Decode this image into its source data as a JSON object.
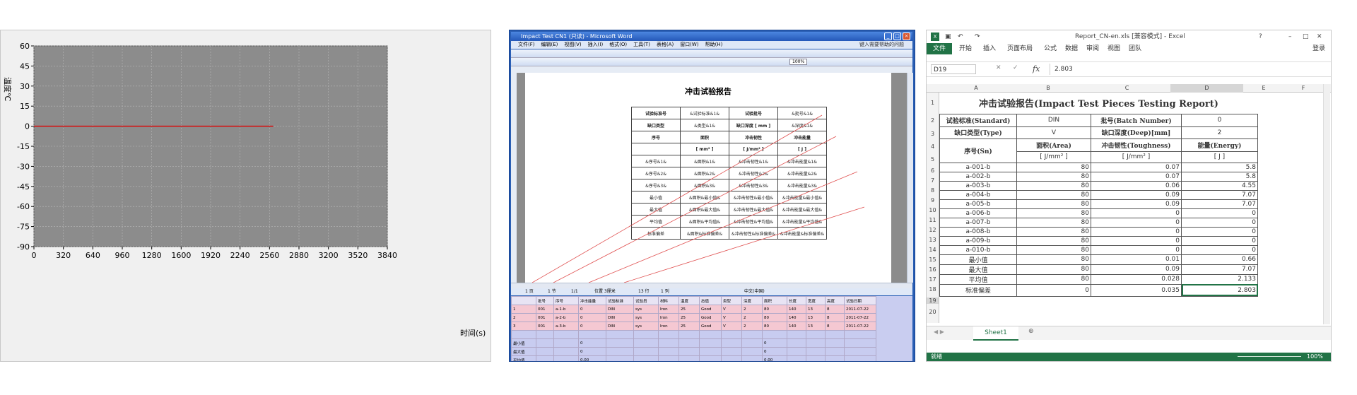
{
  "chart": {
    "ylabel": "温度℃",
    "xlabel": "时间(s)",
    "y_ticks": [
      "60",
      "45",
      "30",
      "15",
      "0",
      "-15",
      "-30",
      "-45",
      "-60",
      "-75",
      "-90"
    ],
    "x_ticks": [
      "0",
      "320",
      "640",
      "960",
      "1280",
      "1600",
      "1920",
      "2240",
      "2560",
      "2880",
      "3200",
      "3520",
      "3840"
    ]
  },
  "chart_data": {
    "type": "line",
    "ylabel": "温度℃",
    "xlabel": "时间(s)",
    "xlim": [
      0,
      3840
    ],
    "ylim": [
      -90,
      60
    ],
    "grid": true,
    "plot_bg": "#8c8c8c",
    "series": [
      {
        "color": "#e00000",
        "x": [
          0,
          2600
        ],
        "y": [
          0,
          0
        ]
      }
    ]
  },
  "word": {
    "title": "Impact Test CN1 (只读) - Microsoft Word",
    "menu": [
      "文件(F)",
      "编辑(E)",
      "视图(V)",
      "插入(I)",
      "格式(O)",
      "工具(T)",
      "表格(A)",
      "窗口(W)",
      "帮助(H)"
    ],
    "help_box": "键入需要帮助的问题",
    "zoom": "100%",
    "doc_title": "冲击试验报告",
    "template_rows": [
      [
        "试验标准号",
        "&试验标准&1&",
        "试验批号",
        "&批号&1&"
      ],
      [
        "缺口类型",
        "&类型&1&",
        "缺口深度 [ mm ]",
        "&深度&1&"
      ],
      [
        "序号",
        "面积",
        "冲击韧性",
        "冲击能量"
      ],
      [
        "",
        "[ mm² ]",
        "[ J/mm² ]",
        "[ J ]"
      ],
      [
        "&序号&1&",
        "&面积&1&",
        "&冲击韧性&1&",
        "&冲击能量&1&"
      ],
      [
        "&序号&2&",
        "&面积&2&",
        "&冲击韧性&2&",
        "&冲击能量&2&"
      ],
      [
        "&序号&3&",
        "&面积&3&",
        "&冲击韧性&3&",
        "&冲击能量&3&"
      ],
      [
        "最小值",
        "&面积&最小值&",
        "&冲击韧性&最小值&",
        "&冲击能量&最小值&"
      ],
      [
        "最大值",
        "&面积&最大值&",
        "&冲击韧性&最大值&",
        "&冲击能量&最大值&"
      ],
      [
        "平均值",
        "&面积&平均值&",
        "&冲击韧性&平均值&",
        "&冲击能量&平均值&"
      ],
      [
        "标准偏差",
        "&面积&标准偏差&",
        "&冲击韧性&标准偏差&",
        "&冲击能量&标准偏差&"
      ]
    ],
    "status": {
      "page": "1 页",
      "section": "1 节",
      "pages": "1/1",
      "pos": "位置 3厘米",
      "line": "13 行",
      "col": "1 列",
      "lang": "中文(中国)"
    },
    "grid_header": [
      "批号",
      "序号",
      "冲击能量",
      "试验标准",
      "试验员",
      "材料",
      "温度",
      "态值",
      "类型",
      "深度",
      "面积",
      "长度",
      "宽度",
      "高度",
      "试验日期"
    ],
    "grid_rows": [
      [
        "1",
        "001",
        "a-1-b",
        "0",
        "DIN",
        "sys",
        "Iron",
        "25",
        "Good",
        "V",
        "2",
        "80",
        "140",
        "13",
        "8",
        "2011-07-22"
      ],
      [
        "2",
        "001",
        "a-2-b",
        "0",
        "DIN",
        "sys",
        "Iron",
        "25",
        "Good",
        "V",
        "2",
        "80",
        "140",
        "13",
        "8",
        "2011-07-22"
      ],
      [
        "3",
        "001",
        "a-3-b",
        "0",
        "DIN",
        "sys",
        "Iron",
        "25",
        "Good",
        "V",
        "2",
        "80",
        "140",
        "13",
        "8",
        "2011-07-22"
      ]
    ],
    "grid_stats": [
      [
        "最小值",
        "0",
        "0"
      ],
      [
        "最大值",
        "0",
        "0"
      ],
      [
        "平均值",
        "0.00",
        "0.00"
      ],
      [
        "标准偏差",
        "0.00",
        "0.00"
      ]
    ]
  },
  "excel": {
    "title": "Report_CN-en.xls [兼容模式] - Excel",
    "tabs": [
      "文件",
      "开始",
      "插入",
      "页面布局",
      "公式",
      "数据",
      "审阅",
      "视图",
      "团队"
    ],
    "login": "登录",
    "namebox": "D19",
    "fx": "fx",
    "formula_value": "2.803",
    "col_headers": [
      "A",
      "B",
      "C",
      "D",
      "E",
      "F"
    ],
    "row_headers": [
      "1",
      "2",
      "3",
      "4",
      "5",
      "6",
      "7",
      "8",
      "9",
      "10",
      "11",
      "12",
      "13",
      "14",
      "15",
      "16",
      "17",
      "18",
      "19",
      "20"
    ],
    "report_title": "冲击试验报告(Impact Test Pieces Testing Report)",
    "standard_label": "试验标准(Standard)",
    "standard_value": "DIN",
    "batch_label": "批号(Batch Number)",
    "batch_value": "0",
    "type_label": "缺口类型(Type)",
    "type_value": "V",
    "deep_label": "缺口深度(Deep)[mm]",
    "deep_value": "2",
    "sn_label": "序号(Sn)",
    "area_label": "面积(Area)",
    "tough_label": "冲击韧性(Toughness)",
    "energy_label": "能量(Energy)",
    "area_unit": "[ J/mm² ]",
    "tough_unit": "[ J/mm² ]",
    "energy_unit": "[ J ]",
    "rows": [
      [
        "a-001-b",
        "80",
        "0.07",
        "5.8"
      ],
      [
        "a-002-b",
        "80",
        "0.07",
        "5.8"
      ],
      [
        "a-003-b",
        "80",
        "0.06",
        "4.55"
      ],
      [
        "a-004-b",
        "80",
        "0.09",
        "7.07"
      ],
      [
        "a-005-b",
        "80",
        "0.09",
        "7.07"
      ],
      [
        "a-006-b",
        "80",
        "0",
        "0"
      ],
      [
        "a-007-b",
        "80",
        "0",
        "0"
      ],
      [
        "a-008-b",
        "80",
        "0",
        "0"
      ],
      [
        "a-009-b",
        "80",
        "0",
        "0"
      ],
      [
        "a-010-b",
        "80",
        "0",
        "0"
      ],
      [
        "最小值",
        "80",
        "0.01",
        "0.66"
      ],
      [
        "最大值",
        "80",
        "0.09",
        "7.07"
      ],
      [
        "平均值",
        "80",
        "0.028",
        "2.133"
      ],
      [
        "标准偏差",
        "0",
        "0.035",
        "2.803"
      ]
    ],
    "sheet_tab": "Sheet1",
    "status_left": "就绪",
    "zoom": "100%",
    "accent": "#217346"
  }
}
